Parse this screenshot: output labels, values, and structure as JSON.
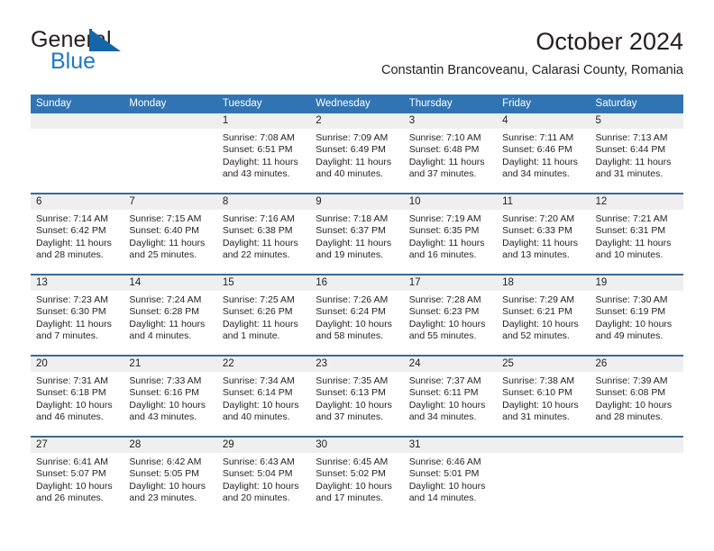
{
  "logo": {
    "word_one": "General",
    "word_two": "Blue",
    "flag_color": "#1565a8",
    "blue_text_color": "#1f7ac4"
  },
  "header": {
    "title": "October 2024",
    "subtitle": "Constantin Brancoveanu, Calarasi County, Romania"
  },
  "colors": {
    "header_bar": "#3174b4",
    "week_separator": "#3a6b96",
    "day_number_band": "#efefef",
    "text": "#231f20"
  },
  "weekdays": [
    "Sunday",
    "Monday",
    "Tuesday",
    "Wednesday",
    "Thursday",
    "Friday",
    "Saturday"
  ],
  "weeks": [
    [
      {
        "day": "",
        "sunrise": "",
        "sunset": "",
        "daylight": ""
      },
      {
        "day": "",
        "sunrise": "",
        "sunset": "",
        "daylight": ""
      },
      {
        "day": "1",
        "sunrise": "Sunrise: 7:08 AM",
        "sunset": "Sunset: 6:51 PM",
        "daylight": "Daylight: 11 hours and 43 minutes."
      },
      {
        "day": "2",
        "sunrise": "Sunrise: 7:09 AM",
        "sunset": "Sunset: 6:49 PM",
        "daylight": "Daylight: 11 hours and 40 minutes."
      },
      {
        "day": "3",
        "sunrise": "Sunrise: 7:10 AM",
        "sunset": "Sunset: 6:48 PM",
        "daylight": "Daylight: 11 hours and 37 minutes."
      },
      {
        "day": "4",
        "sunrise": "Sunrise: 7:11 AM",
        "sunset": "Sunset: 6:46 PM",
        "daylight": "Daylight: 11 hours and 34 minutes."
      },
      {
        "day": "5",
        "sunrise": "Sunrise: 7:13 AM",
        "sunset": "Sunset: 6:44 PM",
        "daylight": "Daylight: 11 hours and 31 minutes."
      }
    ],
    [
      {
        "day": "6",
        "sunrise": "Sunrise: 7:14 AM",
        "sunset": "Sunset: 6:42 PM",
        "daylight": "Daylight: 11 hours and 28 minutes."
      },
      {
        "day": "7",
        "sunrise": "Sunrise: 7:15 AM",
        "sunset": "Sunset: 6:40 PM",
        "daylight": "Daylight: 11 hours and 25 minutes."
      },
      {
        "day": "8",
        "sunrise": "Sunrise: 7:16 AM",
        "sunset": "Sunset: 6:38 PM",
        "daylight": "Daylight: 11 hours and 22 minutes."
      },
      {
        "day": "9",
        "sunrise": "Sunrise: 7:18 AM",
        "sunset": "Sunset: 6:37 PM",
        "daylight": "Daylight: 11 hours and 19 minutes."
      },
      {
        "day": "10",
        "sunrise": "Sunrise: 7:19 AM",
        "sunset": "Sunset: 6:35 PM",
        "daylight": "Daylight: 11 hours and 16 minutes."
      },
      {
        "day": "11",
        "sunrise": "Sunrise: 7:20 AM",
        "sunset": "Sunset: 6:33 PM",
        "daylight": "Daylight: 11 hours and 13 minutes."
      },
      {
        "day": "12",
        "sunrise": "Sunrise: 7:21 AM",
        "sunset": "Sunset: 6:31 PM",
        "daylight": "Daylight: 11 hours and 10 minutes."
      }
    ],
    [
      {
        "day": "13",
        "sunrise": "Sunrise: 7:23 AM",
        "sunset": "Sunset: 6:30 PM",
        "daylight": "Daylight: 11 hours and 7 minutes."
      },
      {
        "day": "14",
        "sunrise": "Sunrise: 7:24 AM",
        "sunset": "Sunset: 6:28 PM",
        "daylight": "Daylight: 11 hours and 4 minutes."
      },
      {
        "day": "15",
        "sunrise": "Sunrise: 7:25 AM",
        "sunset": "Sunset: 6:26 PM",
        "daylight": "Daylight: 11 hours and 1 minute."
      },
      {
        "day": "16",
        "sunrise": "Sunrise: 7:26 AM",
        "sunset": "Sunset: 6:24 PM",
        "daylight": "Daylight: 10 hours and 58 minutes."
      },
      {
        "day": "17",
        "sunrise": "Sunrise: 7:28 AM",
        "sunset": "Sunset: 6:23 PM",
        "daylight": "Daylight: 10 hours and 55 minutes."
      },
      {
        "day": "18",
        "sunrise": "Sunrise: 7:29 AM",
        "sunset": "Sunset: 6:21 PM",
        "daylight": "Daylight: 10 hours and 52 minutes."
      },
      {
        "day": "19",
        "sunrise": "Sunrise: 7:30 AM",
        "sunset": "Sunset: 6:19 PM",
        "daylight": "Daylight: 10 hours and 49 minutes."
      }
    ],
    [
      {
        "day": "20",
        "sunrise": "Sunrise: 7:31 AM",
        "sunset": "Sunset: 6:18 PM",
        "daylight": "Daylight: 10 hours and 46 minutes."
      },
      {
        "day": "21",
        "sunrise": "Sunrise: 7:33 AM",
        "sunset": "Sunset: 6:16 PM",
        "daylight": "Daylight: 10 hours and 43 minutes."
      },
      {
        "day": "22",
        "sunrise": "Sunrise: 7:34 AM",
        "sunset": "Sunset: 6:14 PM",
        "daylight": "Daylight: 10 hours and 40 minutes."
      },
      {
        "day": "23",
        "sunrise": "Sunrise: 7:35 AM",
        "sunset": "Sunset: 6:13 PM",
        "daylight": "Daylight: 10 hours and 37 minutes."
      },
      {
        "day": "24",
        "sunrise": "Sunrise: 7:37 AM",
        "sunset": "Sunset: 6:11 PM",
        "daylight": "Daylight: 10 hours and 34 minutes."
      },
      {
        "day": "25",
        "sunrise": "Sunrise: 7:38 AM",
        "sunset": "Sunset: 6:10 PM",
        "daylight": "Daylight: 10 hours and 31 minutes."
      },
      {
        "day": "26",
        "sunrise": "Sunrise: 7:39 AM",
        "sunset": "Sunset: 6:08 PM",
        "daylight": "Daylight: 10 hours and 28 minutes."
      }
    ],
    [
      {
        "day": "27",
        "sunrise": "Sunrise: 6:41 AM",
        "sunset": "Sunset: 5:07 PM",
        "daylight": "Daylight: 10 hours and 26 minutes."
      },
      {
        "day": "28",
        "sunrise": "Sunrise: 6:42 AM",
        "sunset": "Sunset: 5:05 PM",
        "daylight": "Daylight: 10 hours and 23 minutes."
      },
      {
        "day": "29",
        "sunrise": "Sunrise: 6:43 AM",
        "sunset": "Sunset: 5:04 PM",
        "daylight": "Daylight: 10 hours and 20 minutes."
      },
      {
        "day": "30",
        "sunrise": "Sunrise: 6:45 AM",
        "sunset": "Sunset: 5:02 PM",
        "daylight": "Daylight: 10 hours and 17 minutes."
      },
      {
        "day": "31",
        "sunrise": "Sunrise: 6:46 AM",
        "sunset": "Sunset: 5:01 PM",
        "daylight": "Daylight: 10 hours and 14 minutes."
      },
      {
        "day": "",
        "sunrise": "",
        "sunset": "",
        "daylight": ""
      },
      {
        "day": "",
        "sunrise": "",
        "sunset": "",
        "daylight": ""
      }
    ]
  ]
}
